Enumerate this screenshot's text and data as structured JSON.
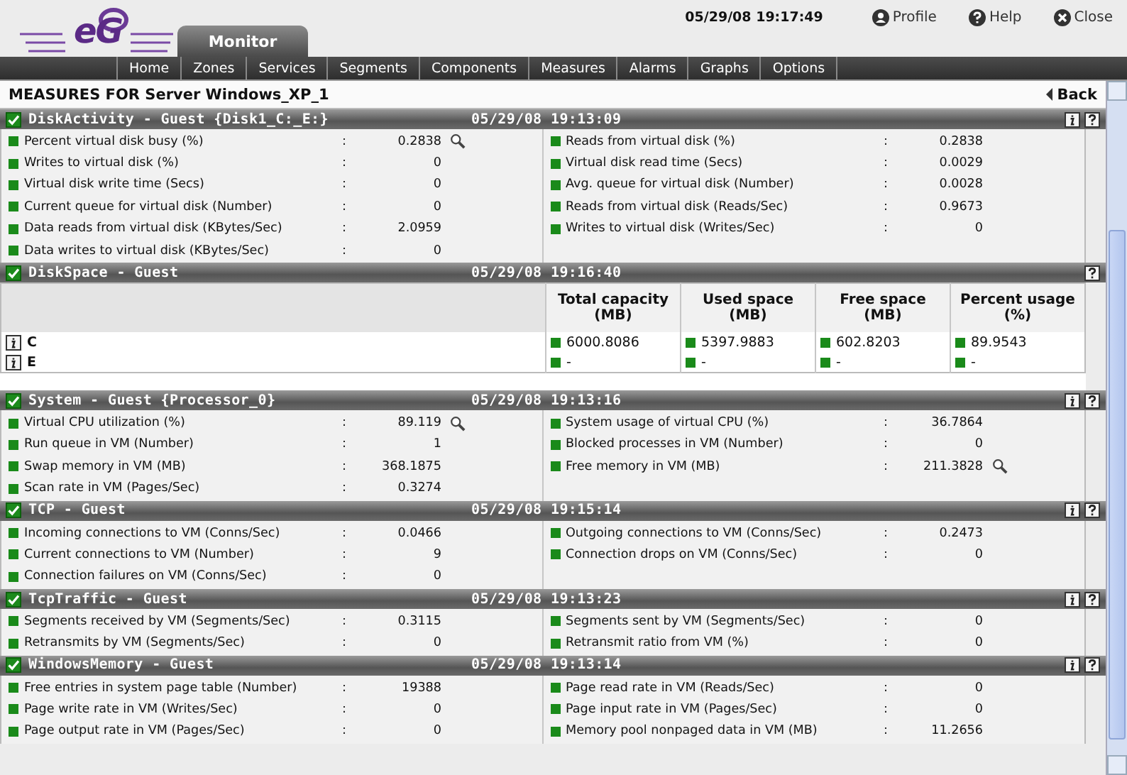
{
  "header": {
    "logo": "eG",
    "tab": {
      "label": "Monitor",
      "selected": true
    },
    "datetime": "05/29/08 19:17:49",
    "links": [
      {
        "kind": "profile",
        "label": "Profile"
      },
      {
        "kind": "help",
        "label": "Help"
      },
      {
        "kind": "close",
        "label": "Close"
      }
    ]
  },
  "nav": [
    "Home",
    "Zones",
    "Services",
    "Segments",
    "Components",
    "Measures",
    "Alarms",
    "Graphs",
    "Options"
  ],
  "page_title": "MEASURES FOR Server Windows_XP_1",
  "back": "Back",
  "separator": ":",
  "sections": [
    {
      "kind": "metrics",
      "title": "DiskActivity - Guest {Disk1_C:_E:}",
      "time": "05/29/08 19:13:09",
      "info_button": true,
      "columns": [
        [
          {
            "label": "Percent virtual disk busy (%)",
            "value": "0.2838",
            "graph": true
          },
          {
            "label": "Writes to virtual disk (%)",
            "value": "0",
            "graph": false
          },
          {
            "label": "Virtual disk write time (Secs)",
            "value": "0",
            "graph": false
          },
          {
            "label": "Current queue for virtual disk (Number)",
            "value": "0",
            "graph": false
          },
          {
            "label": "Data reads from virtual disk (KBytes/Sec)",
            "value": "2.0959",
            "graph": false
          },
          {
            "label": "Data writes to virtual disk (KBytes/Sec)",
            "value": "0",
            "graph": false
          }
        ],
        [
          {
            "label": "Reads from virtual disk (%)",
            "value": "0.2838",
            "graph": false
          },
          {
            "label": "Virtual disk read time (Secs)",
            "value": "0.0029",
            "graph": false
          },
          {
            "label": "Avg. queue for virtual disk (Number)",
            "value": "0.0028",
            "graph": false
          },
          {
            "label": "Reads from virtual disk (Reads/Sec)",
            "value": "0.9673",
            "graph": false
          },
          {
            "label": "Writes to virtual disk (Writes/Sec)",
            "value": "0",
            "graph": false
          }
        ]
      ]
    },
    {
      "kind": "table",
      "title": "DiskSpace - Guest",
      "time": "05/29/08 19:16:40",
      "info_button": false,
      "columns": [
        "Total capacity (MB)",
        "Used space (MB)",
        "Free space (MB)",
        "Percent usage (%)"
      ],
      "rows": [
        {
          "name": "C",
          "cells": [
            "6000.8086",
            "5397.9883",
            "602.8203",
            "89.9543"
          ]
        },
        {
          "name": "E",
          "cells": [
            "-",
            "-",
            "-",
            "-"
          ]
        }
      ]
    },
    {
      "kind": "metrics",
      "title": "System - Guest {Processor_0}",
      "time": "05/29/08 19:13:16",
      "info_button": true,
      "columns": [
        [
          {
            "label": "Virtual CPU utilization (%)",
            "value": "89.119",
            "graph": true
          },
          {
            "label": "Run queue in VM (Number)",
            "value": "1",
            "graph": false
          },
          {
            "label": "Swap memory in VM (MB)",
            "value": "368.1875",
            "graph": false
          },
          {
            "label": "Scan rate in VM (Pages/Sec)",
            "value": "0.3274",
            "graph": false
          }
        ],
        [
          {
            "label": "System usage of virtual CPU (%)",
            "value": "36.7864",
            "graph": false
          },
          {
            "label": "Blocked processes in VM (Number)",
            "value": "0",
            "graph": false
          },
          {
            "label": "Free memory in VM (MB)",
            "value": "211.3828",
            "graph": true
          }
        ]
      ]
    },
    {
      "kind": "metrics",
      "title": "TCP - Guest",
      "time": "05/29/08 19:15:14",
      "info_button": true,
      "columns": [
        [
          {
            "label": "Incoming connections to VM (Conns/Sec)",
            "value": "0.0466",
            "graph": false
          },
          {
            "label": "Current connections to VM (Number)",
            "value": "9",
            "graph": false
          },
          {
            "label": "Connection failures on VM (Conns/Sec)",
            "value": "0",
            "graph": false
          }
        ],
        [
          {
            "label": "Outgoing connections to VM (Conns/Sec)",
            "value": "0.2473",
            "graph": false
          },
          {
            "label": "Connection drops on VM (Conns/Sec)",
            "value": "0",
            "graph": false
          }
        ]
      ]
    },
    {
      "kind": "metrics",
      "title": "TcpTraffic - Guest",
      "time": "05/29/08 19:13:23",
      "info_button": true,
      "columns": [
        [
          {
            "label": "Segments received by VM (Segments/Sec)",
            "value": "0.3115",
            "graph": false
          },
          {
            "label": "Retransmits by VM (Segments/Sec)",
            "value": "0",
            "graph": false
          }
        ],
        [
          {
            "label": "Segments sent by VM (Segments/Sec)",
            "value": "0",
            "graph": false
          },
          {
            "label": "Retransmit ratio from VM (%)",
            "value": "0",
            "graph": false
          }
        ]
      ]
    },
    {
      "kind": "metrics",
      "title": "WindowsMemory - Guest",
      "time": "05/29/08 19:13:14",
      "info_button": true,
      "columns": [
        [
          {
            "label": "Free entries in system page table (Number)",
            "value": "19388",
            "graph": false
          },
          {
            "label": "Page write rate in VM (Writes/Sec)",
            "value": "0",
            "graph": false
          },
          {
            "label": "Page output rate in VM (Pages/Sec)",
            "value": "0",
            "graph": false
          }
        ],
        [
          {
            "label": "Page read rate in VM (Reads/Sec)",
            "value": "0",
            "graph": false
          },
          {
            "label": "Page input rate in VM (Pages/Sec)",
            "value": "0",
            "graph": false
          },
          {
            "label": "Memory pool nonpaged data in VM (MB)",
            "value": "11.2656",
            "graph": false
          }
        ]
      ]
    }
  ]
}
